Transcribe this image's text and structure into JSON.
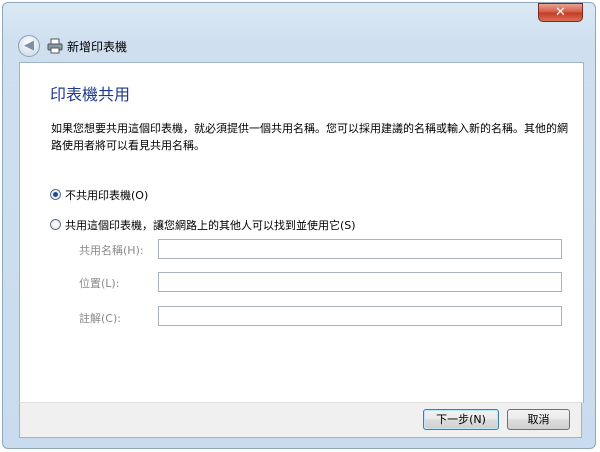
{
  "window": {
    "title": "新增印表機",
    "close_glyph": "✕",
    "back_glyph": "◀"
  },
  "page": {
    "heading": "印表機共用",
    "description": "如果您想要共用這個印表機，就必須提供一個共用名稱。您可以採用建議的名稱或輸入新的名稱。其他的網路使用者將可以看見共用名稱。"
  },
  "options": {
    "no_share_label": "不共用印表機(O)",
    "share_label": "共用這個印表機，讓您網路上的其他人可以找到並使用它(S)",
    "selected": "no_share"
  },
  "fields": {
    "share_name_label": "共用名稱(H):",
    "share_name_value": "",
    "location_label": "位置(L):",
    "location_value": "",
    "comment_label": "註解(C):",
    "comment_value": ""
  },
  "buttons": {
    "next": "下一步(N)",
    "cancel": "取消"
  },
  "colors": {
    "heading": "#1e3a8c",
    "disabled_label": "#8a8a8a"
  }
}
